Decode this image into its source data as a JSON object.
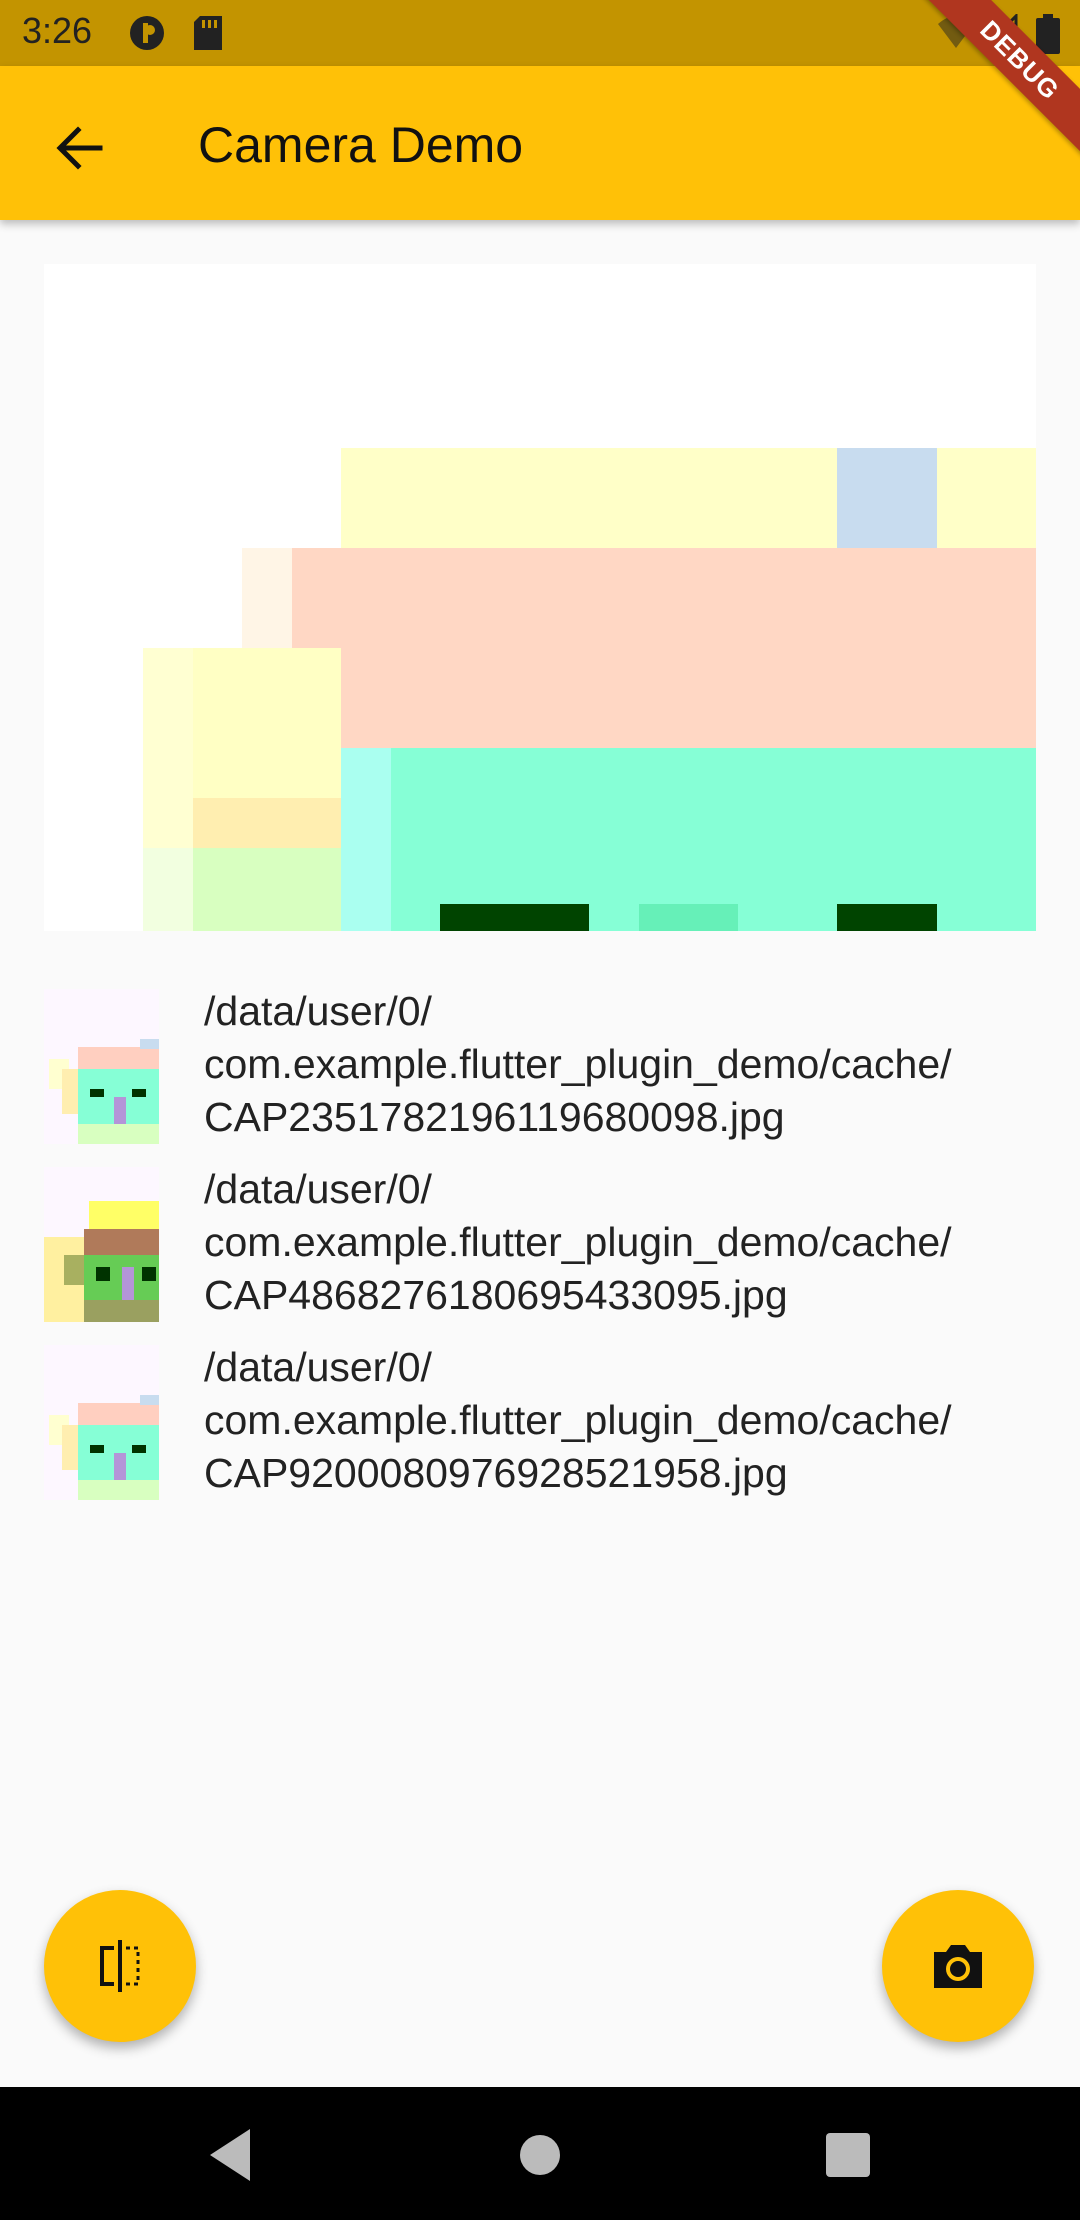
{
  "status_bar": {
    "time": "3:26"
  },
  "debug_banner": {
    "label": "DEBUG"
  },
  "app_bar": {
    "title": "Camera Demo"
  },
  "files": [
    {
      "path": "/data/user/0/\ncom.example.flutter_plugin_demo/cache/\nCAP2351782196119680098.jpg"
    },
    {
      "path": "/data/user/0/\ncom.example.flutter_plugin_demo/cache/\nCAP4868276180695433095.jpg"
    },
    {
      "path": "/data/user/0/\ncom.example.flutter_plugin_demo/cache/\nCAP9200080976928521958.jpg"
    }
  ],
  "colors": {
    "accent": "#ffc107",
    "status_bar": "#c39400",
    "debug": "#b0361f"
  },
  "icons": {
    "back": "arrow-back-icon",
    "switch_camera": "flip-icon",
    "capture": "camera-icon"
  }
}
